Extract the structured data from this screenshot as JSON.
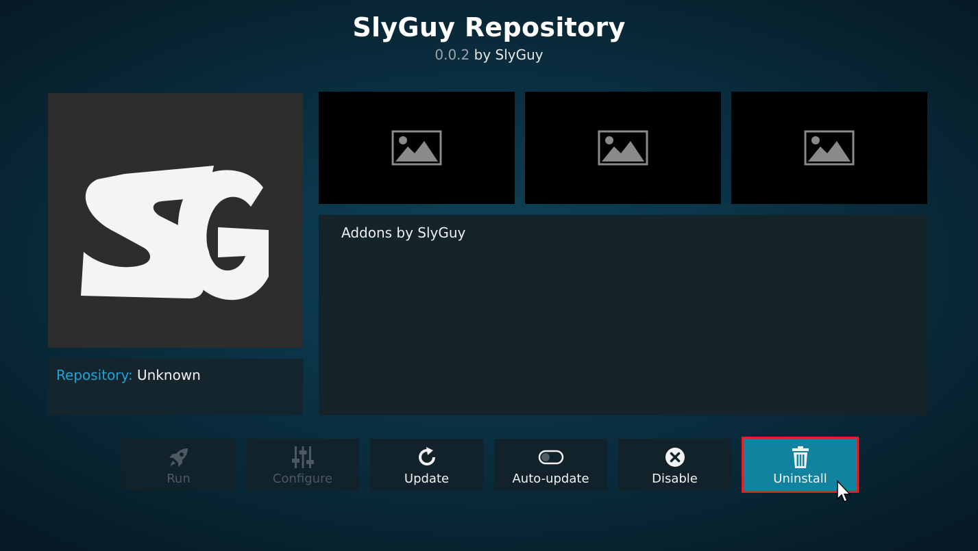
{
  "header": {
    "title": "SlyGuy Repository",
    "version": "0.0.2",
    "author_text": "by SlyGuy"
  },
  "info": {
    "repository_label": "Repository:",
    "repository_value": "Unknown"
  },
  "description": "Addons by SlyGuy",
  "logo_text": "SG",
  "screenshots": [
    {
      "icon": "image-placeholder-icon"
    },
    {
      "icon": "image-placeholder-icon"
    },
    {
      "icon": "image-placeholder-icon"
    }
  ],
  "actions": [
    {
      "label": "Run",
      "icon": "rocket-icon",
      "enabled": false
    },
    {
      "label": "Configure",
      "icon": "sliders-icon",
      "enabled": false
    },
    {
      "label": "Update",
      "icon": "refresh-icon",
      "enabled": true
    },
    {
      "label": "Auto-update",
      "icon": "toggle-icon",
      "enabled": true,
      "toggle_on": false
    },
    {
      "label": "Disable",
      "icon": "close-circle-icon",
      "enabled": true
    },
    {
      "label": "Uninstall",
      "icon": "trash-icon",
      "enabled": true,
      "focused": true
    }
  ],
  "colors": {
    "accent": "#1ba4d8",
    "focused_button": "#12839f",
    "focus_outline": "#e0202a",
    "panel": "#15232b"
  }
}
